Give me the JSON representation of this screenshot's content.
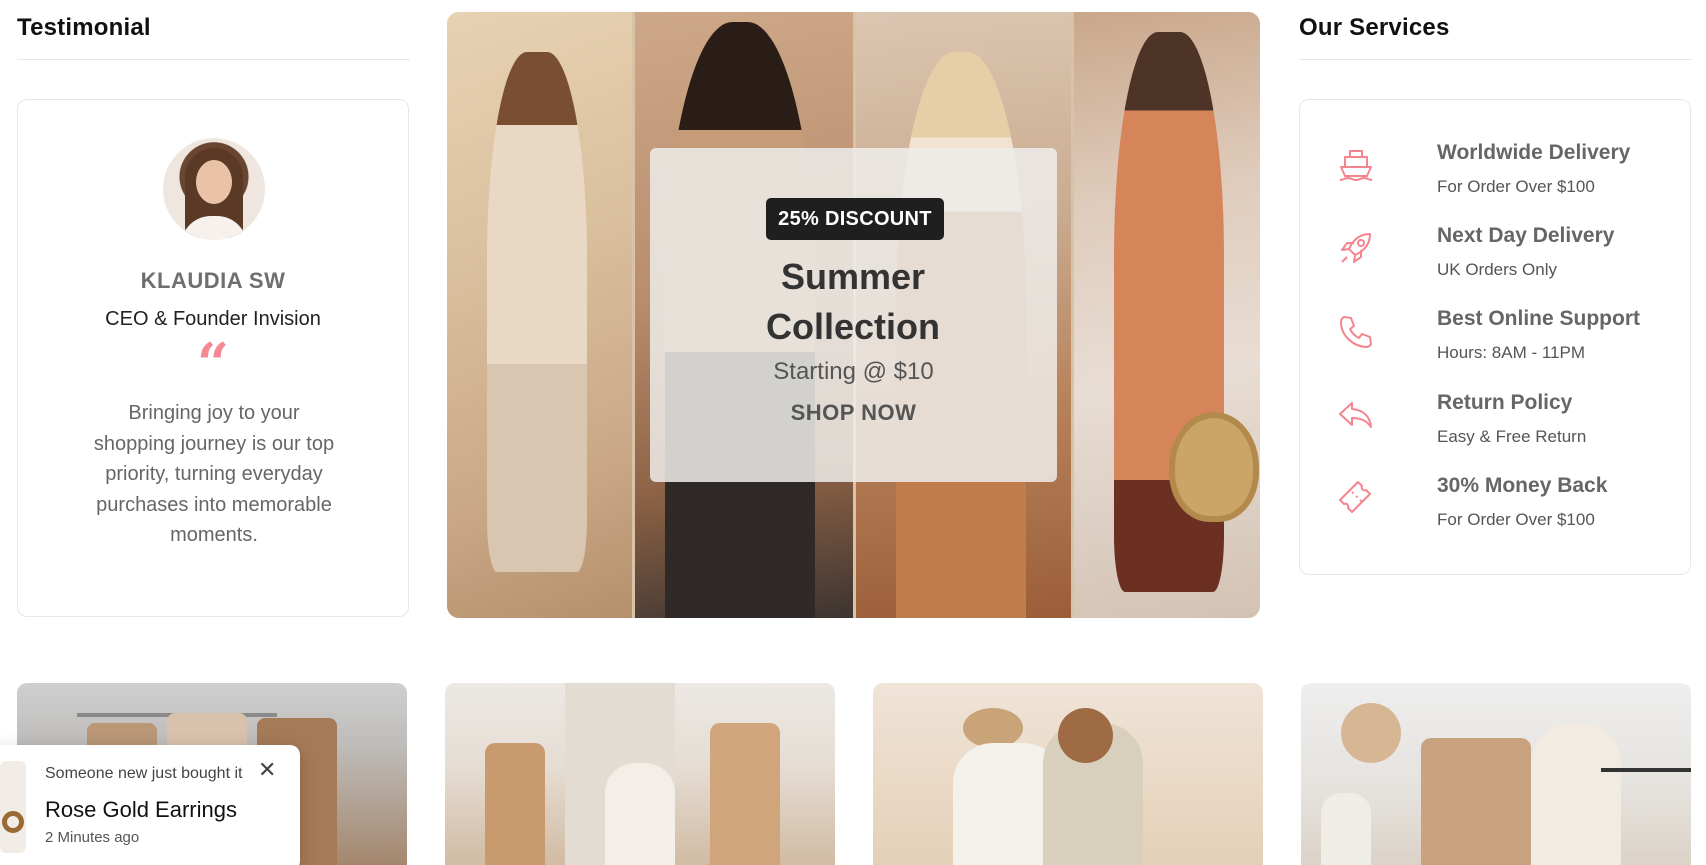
{
  "testimonial": {
    "heading": "Testimonial",
    "name": "KLAUDIA SW",
    "role": "CEO & Founder Invision",
    "quote_mark": "“",
    "text": "Bringing joy to your shopping journey is our top priority, turning everyday purchases into memorable moments."
  },
  "hero": {
    "badge": "25% DISCOUNT",
    "title": "Summer Collection",
    "price": "Starting @ $10",
    "cta": "SHOP NOW"
  },
  "services": {
    "heading": "Our Services",
    "accent_color": "#f4848d",
    "items": [
      {
        "icon": "ship-icon",
        "title": "Worldwide Delivery",
        "subtitle": "For Order Over $100"
      },
      {
        "icon": "rocket-icon",
        "title": "Next Day Delivery",
        "subtitle": "UK Orders Only"
      },
      {
        "icon": "phone-icon",
        "title": "Best Online Support",
        "subtitle": "Hours: 8AM - 11PM"
      },
      {
        "icon": "return-icon",
        "title": "Return Policy",
        "subtitle": "Easy & Free Return"
      },
      {
        "icon": "ticket-icon",
        "title": "30% Money Back",
        "subtitle": "For Order Over $100"
      }
    ]
  },
  "toast": {
    "message": "Someone new just bought it",
    "product": "Rose Gold Earrings",
    "time": "2 Minutes ago",
    "close": "✕"
  }
}
